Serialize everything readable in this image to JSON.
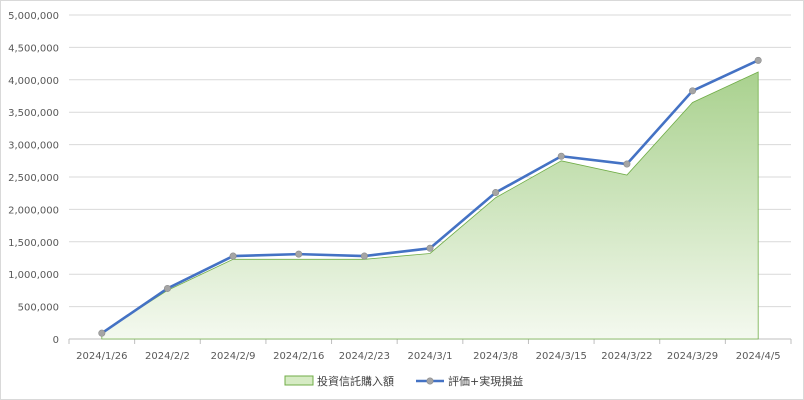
{
  "chart_data": {
    "type": "line+area",
    "categories": [
      "2024/1/26",
      "2024/2/2",
      "2024/2/9",
      "2024/2/16",
      "2024/2/23",
      "2024/3/1",
      "2024/3/8",
      "2024/3/15",
      "2024/3/22",
      "2024/3/29",
      "2024/4/5"
    ],
    "ylim": [
      0,
      5000000
    ],
    "yticks": [
      0,
      500000,
      1000000,
      1500000,
      2000000,
      2500000,
      3000000,
      3500000,
      4000000,
      4500000,
      5000000
    ],
    "ytick_labels": [
      "0",
      "500,000",
      "1,000,000",
      "1,500,000",
      "2,000,000",
      "2,500,000",
      "3,000,000",
      "3,500,000",
      "4,000,000",
      "4,500,000",
      "5,000,000"
    ],
    "grid": true,
    "legend_position": "bottom",
    "series": [
      {
        "name": "投資信託購入額",
        "kind": "area",
        "color": "#70ad47",
        "values": [
          100000,
          750000,
          1230000,
          1230000,
          1230000,
          1320000,
          2180000,
          2750000,
          2530000,
          3650000,
          4120000
        ]
      },
      {
        "name": "評価+実現損益",
        "kind": "line",
        "color": "#4472c4",
        "marker_color": "#a5a5a5",
        "values": [
          90000,
          780000,
          1280000,
          1310000,
          1280000,
          1400000,
          2260000,
          2820000,
          2700000,
          3830000,
          4300000
        ]
      }
    ]
  }
}
